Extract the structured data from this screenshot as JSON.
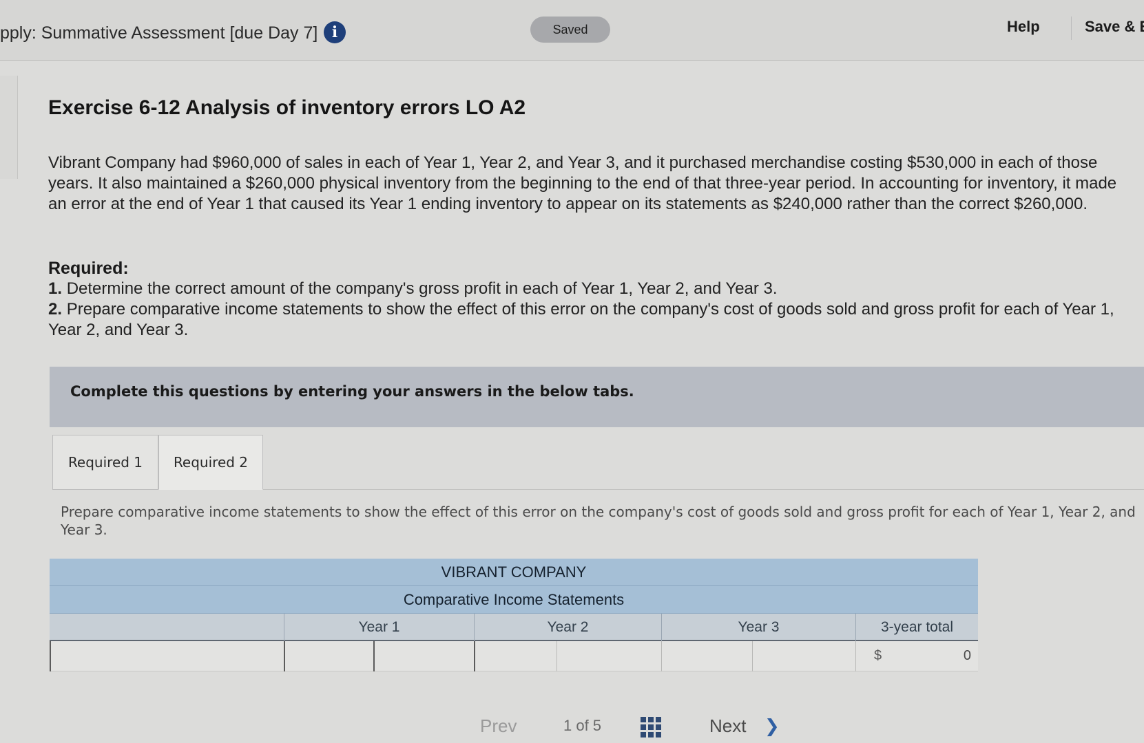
{
  "header": {
    "assignment_title": "pply: Summative Assessment [due Day 7]",
    "status": "Saved",
    "help_label": "Help",
    "save_exit_label": "Save & E"
  },
  "exercise": {
    "title": "Exercise 6-12 Analysis of inventory errors LO A2",
    "description": "Vibrant Company had $960,000 of sales in each of Year 1, Year 2, and Year 3, and it purchased merchandise costing $530,000 in each of those years. It also maintained a $260,000 physical inventory from the beginning to the end of that three-year period. In accounting for inventory, it made an error at the end of Year 1 that caused its Year 1 ending inventory to appear on its statements as $240,000 rather than the correct $260,000.",
    "required_heading": "Required:",
    "requirements": [
      {
        "num": "1.",
        "text": "Determine the correct amount of the company's gross profit in each of Year 1, Year 2, and Year 3."
      },
      {
        "num": "2.",
        "text": "Prepare comparative income statements to show the effect of this error on the company's cost of goods sold and gross profit for each of Year 1, Year 2, and Year 3."
      }
    ]
  },
  "instructions": "Complete this questions by entering your answers in the below tabs.",
  "tabs": [
    {
      "label": "Required 1",
      "active": false
    },
    {
      "label": "Required 2",
      "active": true
    }
  ],
  "prompt": "Prepare comparative income statements to show the effect of this error on the company's cost of goods sold and gross profit for each of Year 1, Year 2, and Year 3.",
  "table": {
    "company": "VIBRANT COMPANY",
    "statement": "Comparative Income Statements",
    "columns": [
      "Year 1",
      "Year 2",
      "Year 3",
      "3-year total"
    ],
    "row": {
      "currency": "$",
      "total_value": "0"
    }
  },
  "pager": {
    "prev_label": "Prev",
    "page_of": "1 of 5",
    "next_label": "Next"
  },
  "colors": {
    "table_header": "#a5bfd6",
    "instruction_band": "#b7bbc3",
    "info_icon": "#1e3f7a"
  }
}
